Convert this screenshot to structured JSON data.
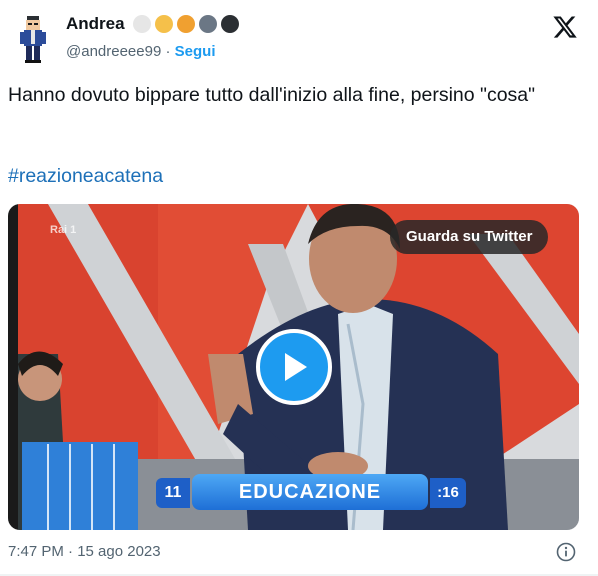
{
  "author": {
    "name": "Andrea",
    "handle": "@andreeee99",
    "separator": "·",
    "follow_label": "Segui",
    "badge_dots": [
      "#e6e6e6",
      "#f5c04a",
      "#f0a030",
      "#6b7785",
      "#2b2f33"
    ]
  },
  "tweet": {
    "text": "Hanno dovuto bippare tutto dall'inizio alla fine, persino \"cosa\"",
    "hashtag": "#reazioneacatena"
  },
  "media": {
    "watch_label": "Guarda su Twitter",
    "channel_logo": "Rai 1",
    "banner_number": "11",
    "banner_word": "EDUCAZIONE",
    "banner_time": ":16"
  },
  "footer": {
    "timestamp": "7:47 PM · 15 ago 2023"
  },
  "icons": {
    "x_logo": "x-logo-icon",
    "play": "play-icon",
    "info": "info-icon"
  },
  "colors": {
    "accent": "#1d9bf0",
    "hashtag": "#1d70b8",
    "secondary_text": "#536471"
  }
}
